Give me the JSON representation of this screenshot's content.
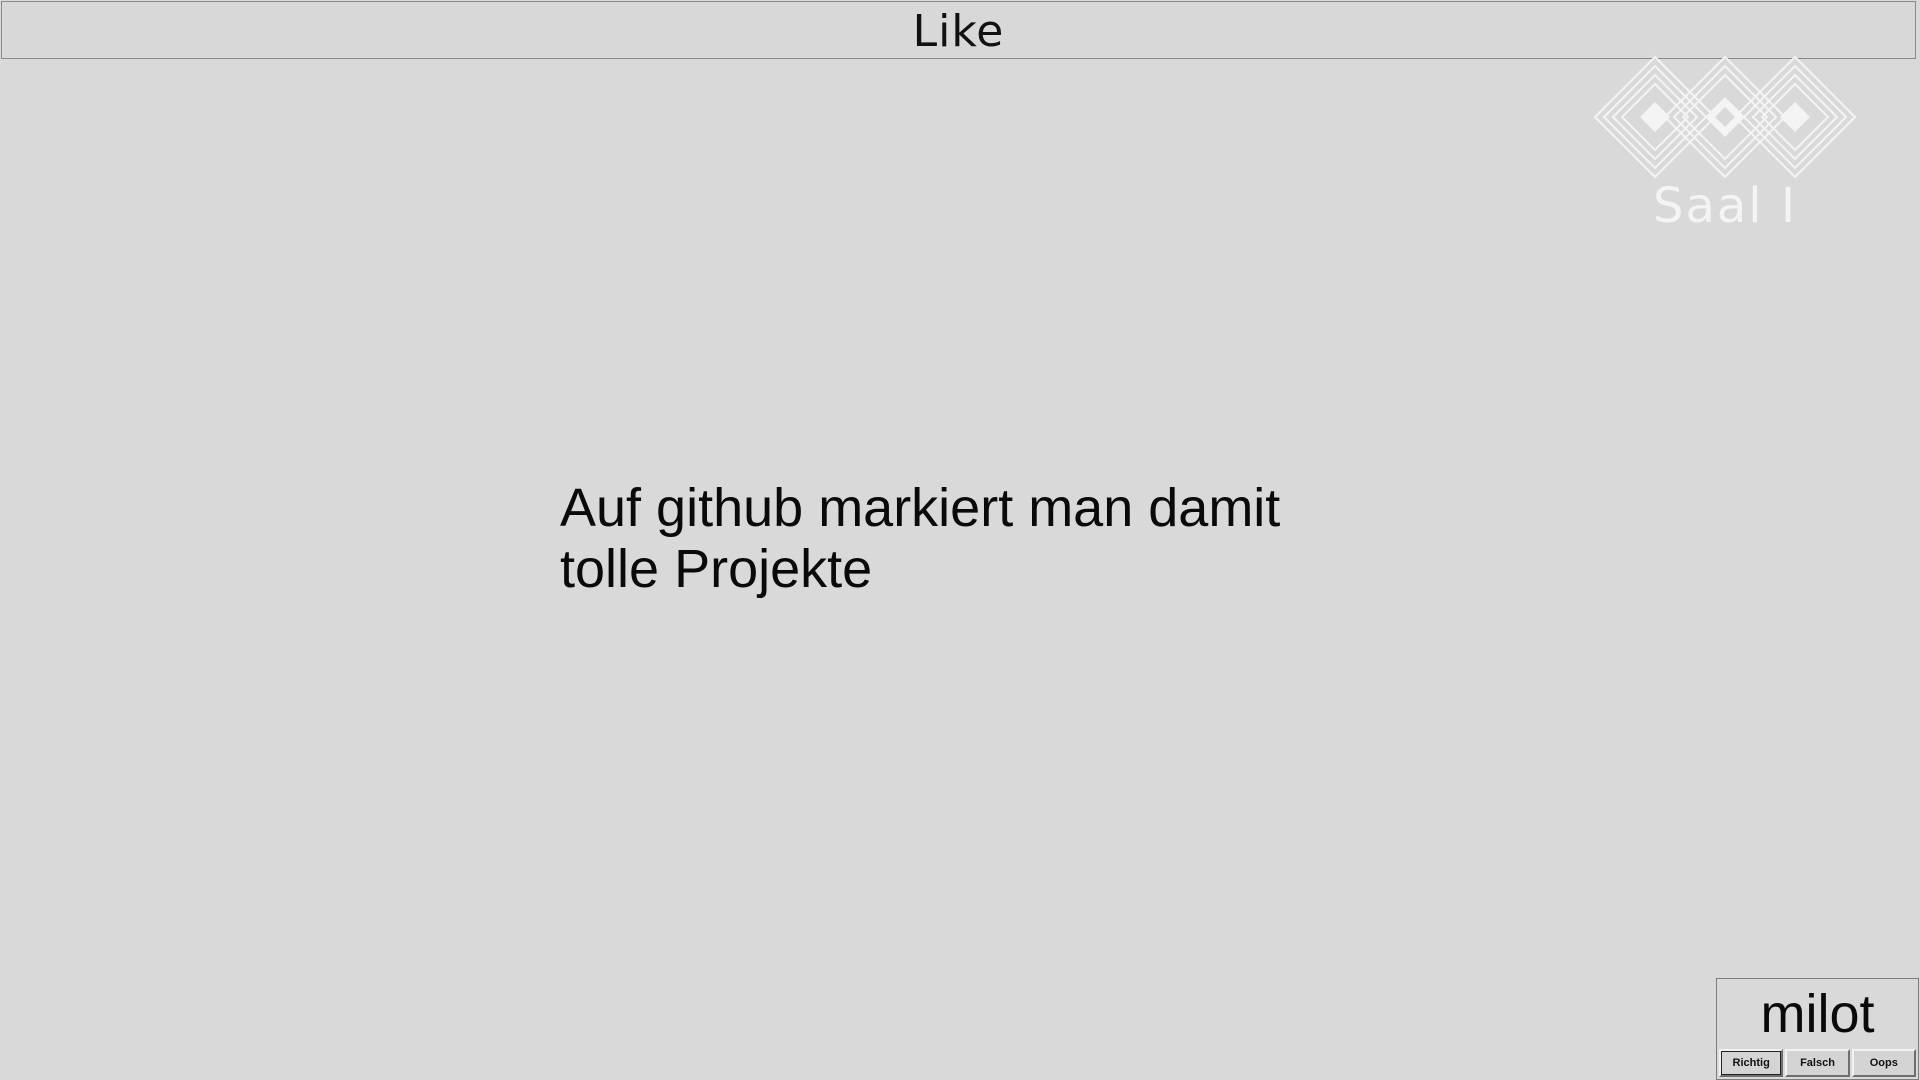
{
  "header": {
    "title": "Like"
  },
  "logo": {
    "icon": "event-logo-icon",
    "room_label": "Saal I"
  },
  "question": {
    "lines": [
      "Auf github markiert man damit",
      "tolle Projekte"
    ]
  },
  "player": {
    "name": "milot",
    "buttons": {
      "correct": "Richtig",
      "wrong": "Falsch",
      "oops": "Oops"
    }
  },
  "colors": {
    "background": "#d9d9d9",
    "text": "#0a0a0a",
    "logo": "#f4f4f4"
  }
}
